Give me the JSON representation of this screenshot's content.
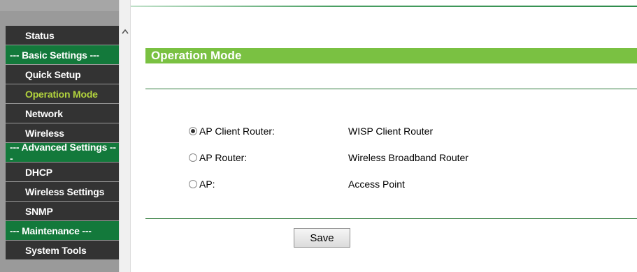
{
  "sidebar": {
    "items": [
      {
        "type": "page",
        "label": "Status"
      },
      {
        "type": "section",
        "label": "--- Basic Settings ---"
      },
      {
        "type": "page",
        "label": "Quick Setup"
      },
      {
        "type": "page",
        "label": "Operation Mode",
        "active": true
      },
      {
        "type": "page",
        "label": "Network"
      },
      {
        "type": "page",
        "label": "Wireless"
      },
      {
        "type": "section",
        "label": "--- Advanced Settings ---"
      },
      {
        "type": "page",
        "label": "DHCP"
      },
      {
        "type": "page",
        "label": "Wireless Settings"
      },
      {
        "type": "page",
        "label": "SNMP"
      },
      {
        "type": "section",
        "label": "--- Maintenance ---"
      },
      {
        "type": "page",
        "label": "System Tools"
      }
    ]
  },
  "main": {
    "title": "Operation Mode",
    "options": [
      {
        "label": "AP Client Router:",
        "description": "WISP Client Router",
        "selected": true
      },
      {
        "label": "AP Router:",
        "description": "Wireless Broadband Router",
        "selected": false
      },
      {
        "label": "AP:",
        "description": "Access Point",
        "selected": false
      }
    ],
    "save_label": "Save"
  },
  "colors": {
    "sidebar_page_bg": "#333333",
    "sidebar_section_bg": "#13793b",
    "active_item_text": "#b2d33d",
    "title_bar_bg": "#7ac142",
    "divider": "#2e7a3a"
  },
  "icons": {
    "scroll_up": "chevron-up-icon"
  }
}
